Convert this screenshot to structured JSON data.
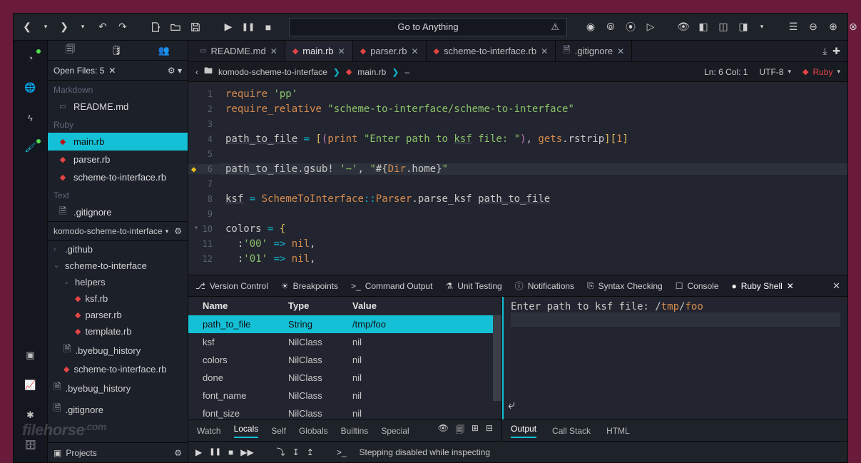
{
  "toolbar": {
    "goto_placeholder": "Go to Anything"
  },
  "sidebar": {
    "open_files_label": "Open Files: 5",
    "groups": [
      {
        "label": "Markdown",
        "items": [
          {
            "name": "README.md",
            "icon": "md"
          }
        ]
      },
      {
        "label": "Ruby",
        "items": [
          {
            "name": "main.rb",
            "icon": "ruby",
            "active": true
          },
          {
            "name": "parser.rb",
            "icon": "ruby"
          },
          {
            "name": "scheme-to-interface.rb",
            "icon": "ruby"
          }
        ]
      },
      {
        "label": "Text",
        "items": [
          {
            "name": ".gitignore",
            "icon": "txt"
          }
        ]
      }
    ],
    "project_title": "komodo-scheme-to-interface",
    "tree": [
      {
        "label": ".github",
        "indent": 0,
        "icon": "caret-r"
      },
      {
        "label": "scheme-to-interface",
        "indent": 0,
        "icon": "caret-d"
      },
      {
        "label": "helpers",
        "indent": 1,
        "icon": "caret-d"
      },
      {
        "label": "ksf.rb",
        "indent": 2,
        "icon": "ruby"
      },
      {
        "label": "parser.rb",
        "indent": 2,
        "icon": "ruby"
      },
      {
        "label": "template.rb",
        "indent": 2,
        "icon": "ruby"
      },
      {
        "label": ".byebug_history",
        "indent": 1,
        "icon": "txt"
      },
      {
        "label": "scheme-to-interface.rb",
        "indent": 1,
        "icon": "ruby"
      },
      {
        "label": ".byebug_history",
        "indent": 0,
        "icon": "txt"
      },
      {
        "label": ".gitignore",
        "indent": 0,
        "icon": "txt"
      }
    ],
    "projects_label": "Projects"
  },
  "tabs": [
    {
      "label": "README.md",
      "icon": "md"
    },
    {
      "label": "main.rb",
      "icon": "ruby",
      "active": true
    },
    {
      "label": "parser.rb",
      "icon": "ruby"
    },
    {
      "label": "scheme-to-interface.rb",
      "icon": "ruby"
    },
    {
      "label": ".gitignore",
      "icon": "txt"
    }
  ],
  "breadcrumb": {
    "folder": "komodo-scheme-to-interface",
    "file": "main.rb",
    "pos": "Ln: 6 Col: 1",
    "encoding": "UTF-8",
    "language": "Ruby"
  },
  "code": {
    "lines": [
      {
        "n": 1,
        "html": "<span class='kw'>require</span> <span class='str'>'pp'</span>"
      },
      {
        "n": 2,
        "html": "<span class='kw'>require_relative</span> <span class='str'>\"scheme-to-interface/scheme-to-interface\"</span>"
      },
      {
        "n": 3,
        "html": ""
      },
      {
        "n": 4,
        "html": "<span class='var und'>path_to_file</span> <span class='op'>=</span> <span class='paren-y'>[</span><span class='paren-p'>(</span><span class='kw'>print</span> <span class='str'>\"Enter path to <span class='und'>ksf</span> file: \"</span><span class='paren-p'>)</span><span class='punct'>,</span> <span class='kw'>gets</span><span class='punct'>.</span><span class='var'>rstrip</span><span class='paren-y'>]</span><span class='paren-y'>[</span><span class='brk'>1</span><span class='paren-y'>]</span>"
      },
      {
        "n": 5,
        "html": ""
      },
      {
        "n": 6,
        "html": "<span class='var und'>path_to_file</span><span class='punct'>.</span><span class='var'>gsub!</span> <span class='str'>'~'</span><span class='punct'>,</span> <span class='str'>\"</span><span class='interp'>#{</span><span class='kw'>Dir</span><span class='punct'>.</span><span class='var'>home</span><span class='interp'>}</span><span class='str'>\"</span>",
        "current": true,
        "bp": true
      },
      {
        "n": 7,
        "html": ""
      },
      {
        "n": 8,
        "html": "<span class='var und'>ksf</span> <span class='op'>=</span> <span class='kw'>SchemeToInterface</span><span class='op'>::</span><span class='kw'>Parser</span><span class='punct'>.</span><span class='var'>parse_ksf</span> <span class='var und'>path_to_file</span>"
      },
      {
        "n": 9,
        "html": ""
      },
      {
        "n": 10,
        "html": "<span class='var'>colors</span> <span class='op'>=</span> <span class='paren-y'>{</span>",
        "fold": true
      },
      {
        "n": 11,
        "html": "  <span class='sym'>:</span><span class='str'>'00'</span> <span class='op'>=></span> <span class='kw'>nil</span><span class='punct'>,</span>"
      },
      {
        "n": 12,
        "html": "  <span class='sym'>:</span><span class='str'>'01'</span> <span class='op'>=></span> <span class='kw'>nil</span><span class='punct'>,</span>"
      }
    ]
  },
  "bottom": {
    "panel_tabs": [
      {
        "label": "Version Control",
        "icon": "branch"
      },
      {
        "label": "Breakpoints",
        "icon": "bug"
      },
      {
        "label": "Command Output",
        "icon": "prompt"
      },
      {
        "label": "Unit Testing",
        "icon": "flask"
      },
      {
        "label": "Notifications",
        "icon": "info"
      },
      {
        "label": "Syntax Checking",
        "icon": "check"
      },
      {
        "label": "Console",
        "icon": "monitor"
      },
      {
        "label": "Ruby Shell",
        "icon": "dot",
        "active": true,
        "closable": true
      }
    ],
    "locals": {
      "headers": {
        "name": "Name",
        "type": "Type",
        "value": "Value"
      },
      "rows": [
        {
          "name": "path_to_file",
          "type": "String",
          "value": "/tmp/foo",
          "selected": true
        },
        {
          "name": "ksf",
          "type": "NilClass",
          "value": "nil"
        },
        {
          "name": "colors",
          "type": "NilClass",
          "value": "nil"
        },
        {
          "name": "done",
          "type": "NilClass",
          "value": "nil"
        },
        {
          "name": "font_name",
          "type": "NilClass",
          "value": "nil"
        },
        {
          "name": "font_size",
          "type": "NilClass",
          "value": "nil"
        }
      ],
      "footer_tabs": [
        "Watch",
        "Locals",
        "Self",
        "Globals",
        "Builtins",
        "Special"
      ],
      "footer_active": "Locals"
    },
    "shell": {
      "prompt": "Enter path to ksf file: ",
      "input": "/tmp/foo",
      "footer_tabs": [
        "Output",
        "Call Stack",
        "HTML"
      ],
      "footer_active": "Output"
    }
  },
  "debug": {
    "message": "Stepping disabled while inspecting"
  }
}
